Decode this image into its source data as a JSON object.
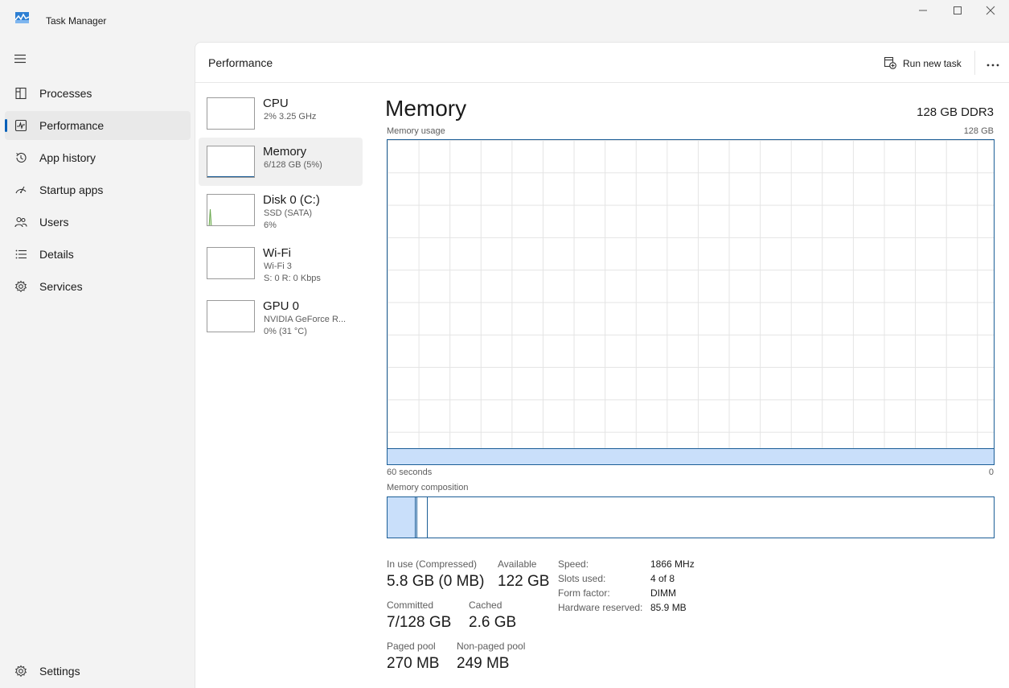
{
  "window": {
    "title": "Task Manager"
  },
  "nav": {
    "items": [
      {
        "label": "Processes",
        "icon": "processes-icon"
      },
      {
        "label": "Performance",
        "icon": "performance-icon"
      },
      {
        "label": "App history",
        "icon": "history-icon"
      },
      {
        "label": "Startup apps",
        "icon": "startup-icon"
      },
      {
        "label": "Users",
        "icon": "users-icon"
      },
      {
        "label": "Details",
        "icon": "details-icon"
      },
      {
        "label": "Services",
        "icon": "services-icon"
      }
    ],
    "selected": "Performance",
    "settings_label": "Settings"
  },
  "header": {
    "title": "Performance",
    "run_new_task_label": "Run new task"
  },
  "devices": [
    {
      "name": "CPU",
      "sub1": "2%  3.25 GHz",
      "sub2": ""
    },
    {
      "name": "Memory",
      "sub1": "6/128 GB (5%)",
      "sub2": ""
    },
    {
      "name": "Disk 0 (C:)",
      "sub1": "SSD (SATA)",
      "sub2": "6%"
    },
    {
      "name": "Wi-Fi",
      "sub1": "Wi-Fi 3",
      "sub2": "S: 0  R: 0 Kbps"
    },
    {
      "name": "GPU 0",
      "sub1": "NVIDIA GeForce R...",
      "sub2": "0%  (31 °C)"
    }
  ],
  "memory": {
    "title": "Memory",
    "spec": "128 GB DDR3",
    "usage_label": "Memory usage",
    "usage_max": "128 GB",
    "time_left": "60 seconds",
    "time_right": "0",
    "usage_fraction": 0.05,
    "composition_label": "Memory composition",
    "composition": {
      "in_use_fraction": 0.046,
      "modified_fraction": 0.003,
      "standby_fraction": 0.02
    },
    "stats": {
      "in_use_label": "In use (Compressed)",
      "in_use_value": "5.8 GB (0 MB)",
      "available_label": "Available",
      "available_value": "122 GB",
      "committed_label": "Committed",
      "committed_value": "7/128 GB",
      "cached_label": "Cached",
      "cached_value": "2.6 GB",
      "paged_pool_label": "Paged pool",
      "paged_pool_value": "270 MB",
      "nonpaged_pool_label": "Non-paged pool",
      "nonpaged_pool_value": "249 MB"
    },
    "specs": [
      {
        "key": "Speed:",
        "value": "1866 MHz"
      },
      {
        "key": "Slots used:",
        "value": "4 of 8"
      },
      {
        "key": "Form factor:",
        "value": "DIMM"
      },
      {
        "key": "Hardware reserved:",
        "value": "85.9 MB"
      }
    ]
  },
  "colors": {
    "accent": "#005fb8",
    "graph_line": "#1c5e97",
    "graph_fill": "#c9dffa",
    "disk_graph": "#6aa84f"
  }
}
